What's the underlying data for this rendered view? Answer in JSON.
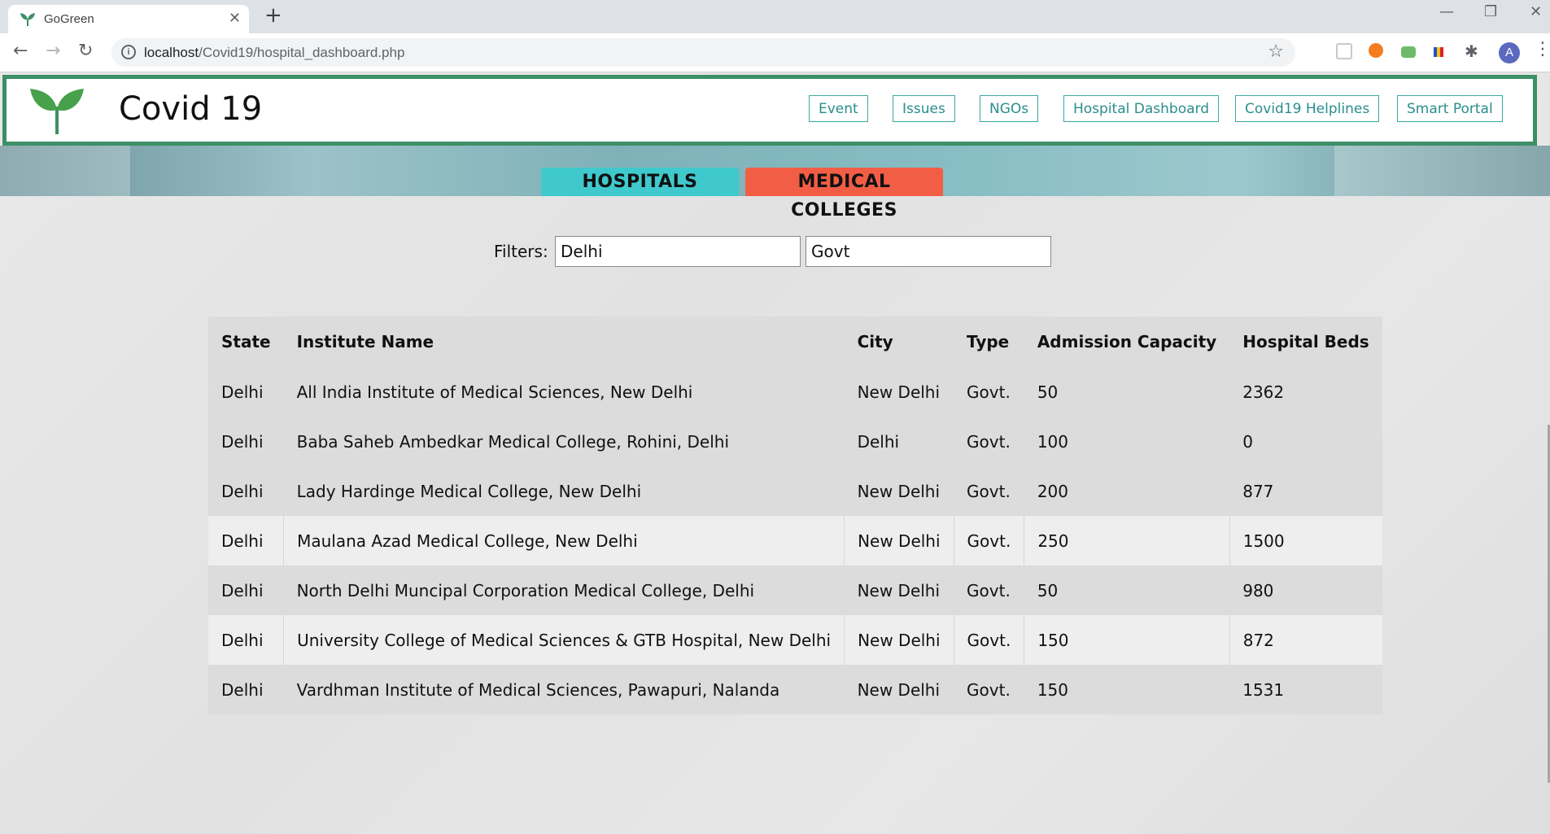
{
  "browser": {
    "tab_title": "GoGreen",
    "url_host": "localhost",
    "url_path": "/Covid19/hospital_dashboard.php",
    "profile_initial": "A"
  },
  "site": {
    "title": "Covid 19",
    "nav": [
      "Event",
      "Issues",
      "NGOs",
      "Hospital Dashboard",
      "Covid19 Helplines",
      "Smart Portal"
    ],
    "tabs": {
      "hospitals": "HOSPITALS",
      "medical_colleges": "MEDICAL COLLEGES"
    },
    "colors": {
      "header_border": "#3d8f66",
      "hospitals_tab": "#3fc9cd",
      "medical_tab": "#f25e45",
      "nav_link": "#2a8d8d"
    }
  },
  "filters": {
    "label": "Filters:",
    "state_value": "Delhi",
    "type_value": "Govt"
  },
  "table": {
    "headers": [
      "State",
      "Institute Name",
      "City",
      "Type",
      "Admission Capacity",
      "Hospital Beds"
    ],
    "rows": [
      [
        "Delhi",
        "All India Institute of Medical Sciences, New Delhi",
        "New Delhi",
        "Govt.",
        "50",
        "2362"
      ],
      [
        "Delhi",
        "Baba Saheb Ambedkar Medical College, Rohini, Delhi",
        "Delhi",
        "Govt.",
        "100",
        "0"
      ],
      [
        "Delhi",
        "Lady Hardinge Medical College, New Delhi",
        "New Delhi",
        "Govt.",
        "200",
        "877"
      ],
      [
        "Delhi",
        "Maulana Azad Medical College, New Delhi",
        "New Delhi",
        "Govt.",
        "250",
        "1500"
      ],
      [
        "Delhi",
        "North Delhi Muncipal Corporation Medical College, Delhi",
        "New Delhi",
        "Govt.",
        "50",
        "980"
      ],
      [
        "Delhi",
        "University College of Medical Sciences & GTB Hospital, New Delhi",
        "New Delhi",
        "Govt.",
        "150",
        "872"
      ],
      [
        "Delhi",
        "Vardhman Institute of Medical Sciences, Pawapuri, Nalanda",
        "New Delhi",
        "Govt.",
        "150",
        "1531"
      ]
    ]
  }
}
